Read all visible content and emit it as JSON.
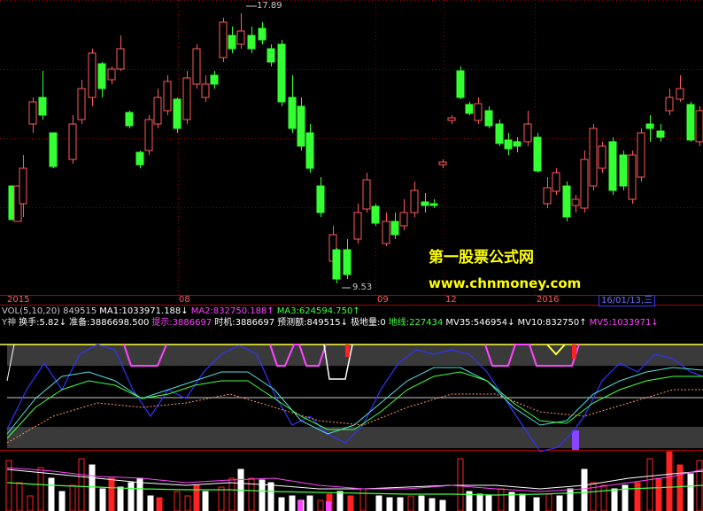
{
  "timeline": {
    "labels": [
      "2015",
      "08",
      "09",
      "12",
      "2016"
    ],
    "current_date": "16/01/13,三"
  },
  "price": {
    "high_label": "17.89",
    "low_label": "9.53"
  },
  "vol_bar": {
    "name": "VOL(5,10,20)",
    "value": "849515",
    "ma1_label": "MA1:1033971.188",
    "ma1_arrow": "↓",
    "ma2_label": "MA2:832750.188",
    "ma2_arrow": "↑",
    "ma3_label": "MA3:624594.750",
    "ma3_arrow": "↑"
  },
  "indicator_bar": {
    "name": "Y神",
    "turnover": "换手:5.82",
    "turnover_arrow": "↓",
    "prepare": "准备:3886698.500",
    "hint": "提示:3886697",
    "timing": "时机:3886697",
    "predict": "预测额:849515",
    "predict_arrow": "↓",
    "extreme": "极地量:0",
    "ground": "地线:227434",
    "mv35": "MV35:546954",
    "mv35_arrow": "↓",
    "mv10": "MV10:832750",
    "mv10_arrow": "↑",
    "mv5": "MV5:1033971",
    "mv5_arrow": "↓"
  },
  "watermark": {
    "title": "第一股票公式网",
    "url": "www.chnmoney.com"
  },
  "colors": {
    "up": "#ff5a5a",
    "down": "#33ff33",
    "vol_label": "#c8c8c8",
    "ma1": "#ffffff",
    "ma2": "#ff44ff",
    "ma3": "#44ff44",
    "magenta": "#ff44ff",
    "yellow": "#ffff44",
    "watermark": "#ffff00"
  }
}
